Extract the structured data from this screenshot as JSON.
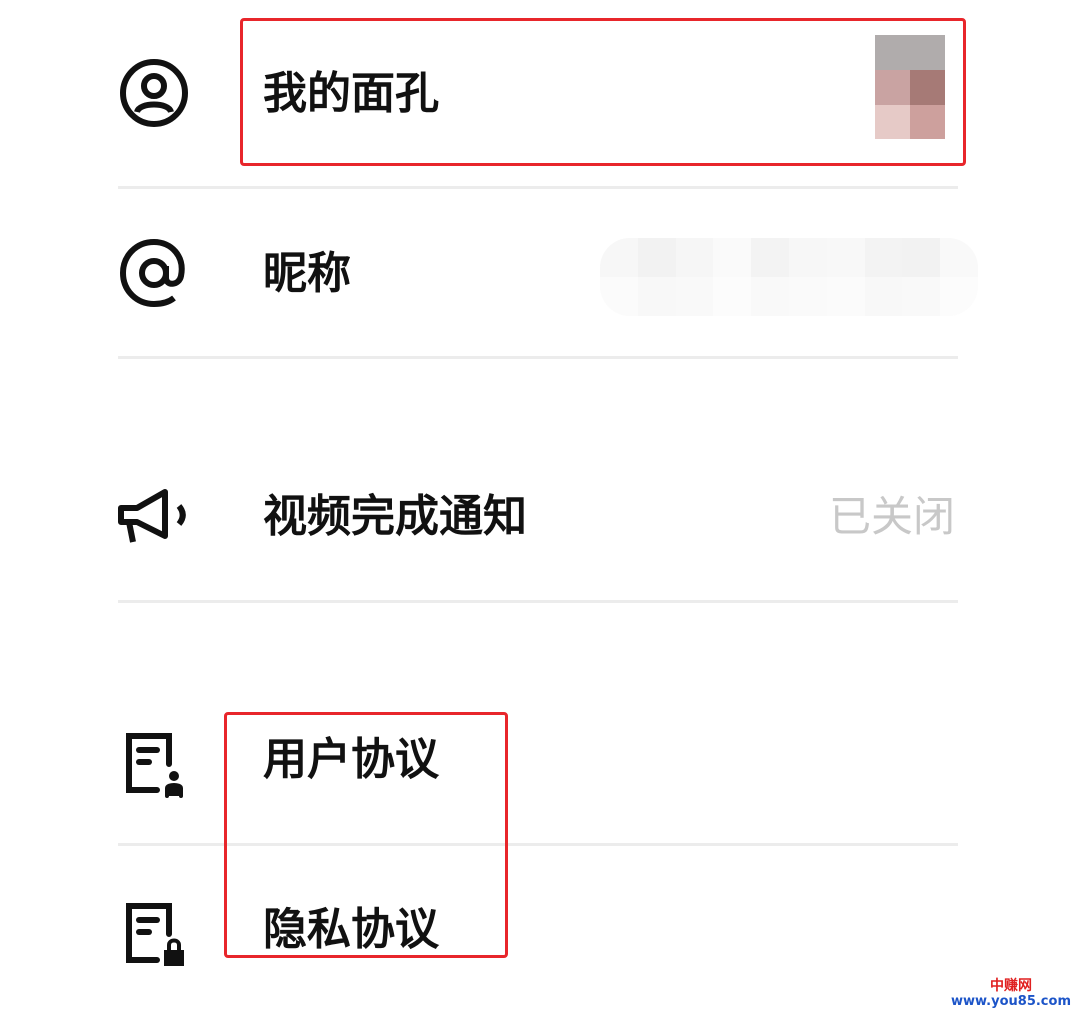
{
  "rows": {
    "face": {
      "label": "我的面孔",
      "icon": "user-circle-icon"
    },
    "nickname": {
      "label": "昵称",
      "icon": "at-sign-icon"
    },
    "video_notify": {
      "label": "视频完成通知",
      "value": "已关闭",
      "icon": "megaphone-icon"
    },
    "user_agreement": {
      "label": "用户协议",
      "icon": "document-person-icon"
    },
    "privacy_agreement": {
      "label": "隐私协议",
      "icon": "document-lock-icon"
    }
  },
  "watermark": {
    "top": "中赚网",
    "bottom": "www.you85.com"
  },
  "colors": {
    "highlight": "#e8262b",
    "label": "#111111",
    "muted_value": "#c8c8c8",
    "divider": "#ececec"
  }
}
